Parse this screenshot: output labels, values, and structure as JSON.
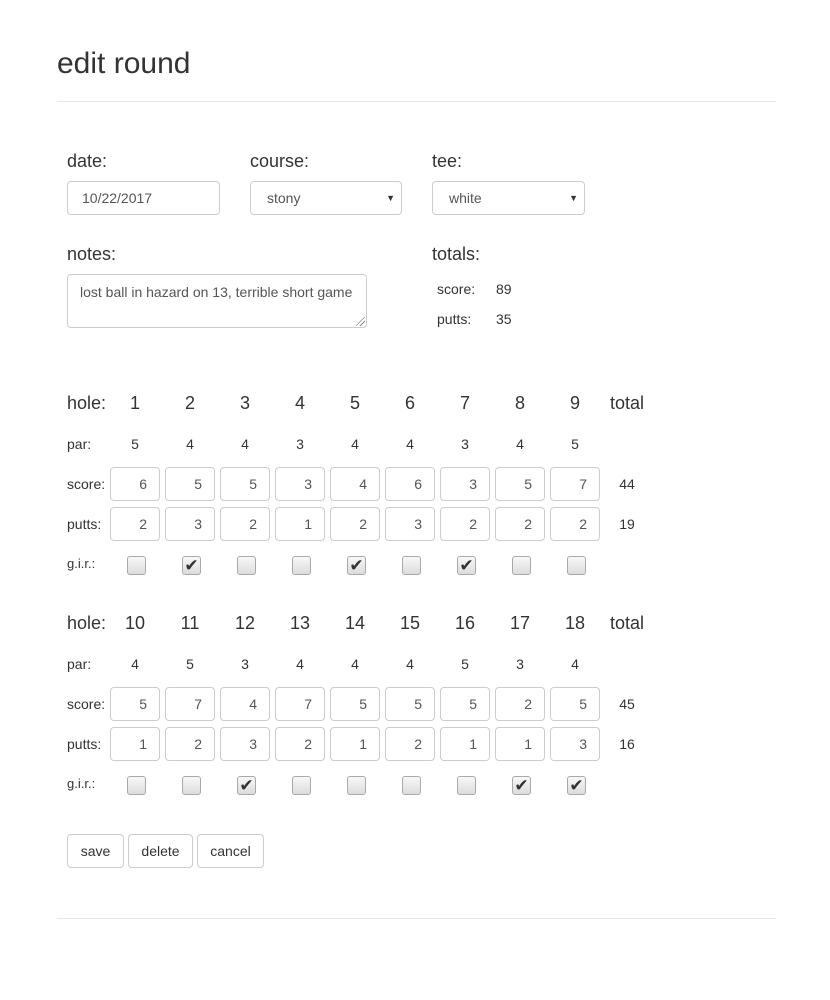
{
  "page": {
    "title": "edit round"
  },
  "form": {
    "date": {
      "label": "date:",
      "value": "10/22/2017"
    },
    "course": {
      "label": "course:",
      "value": "stony"
    },
    "tee": {
      "label": "tee:",
      "value": "white"
    },
    "notes": {
      "label": "notes:",
      "value": "lost ball in hazard on 13, terrible short game"
    },
    "totals": {
      "label": "totals:",
      "score_label": "score:",
      "score_value": "89",
      "putts_label": "putts:",
      "putts_value": "35"
    }
  },
  "row_labels": {
    "hole": "hole:",
    "par": "par:",
    "score": "score:",
    "putts": "putts:",
    "gir": "g.i.r.:",
    "total": "total"
  },
  "icons": {
    "select_caret": "chevron-down-icon",
    "checkmark": "checkmark-icon",
    "resize": "resize-grip-icon"
  },
  "nines": [
    {
      "holes": [
        "1",
        "2",
        "3",
        "4",
        "5",
        "6",
        "7",
        "8",
        "9"
      ],
      "par": [
        "5",
        "4",
        "4",
        "3",
        "4",
        "4",
        "3",
        "4",
        "5"
      ],
      "score": [
        "6",
        "5",
        "5",
        "3",
        "4",
        "6",
        "3",
        "5",
        "7"
      ],
      "putts": [
        "2",
        "3",
        "2",
        "1",
        "2",
        "3",
        "2",
        "2",
        "2"
      ],
      "gir": [
        false,
        true,
        false,
        false,
        true,
        false,
        true,
        false,
        false
      ],
      "score_total": "44",
      "putts_total": "19"
    },
    {
      "holes": [
        "10",
        "11",
        "12",
        "13",
        "14",
        "15",
        "16",
        "17",
        "18"
      ],
      "par": [
        "4",
        "5",
        "3",
        "4",
        "4",
        "4",
        "5",
        "3",
        "4"
      ],
      "score": [
        "5",
        "7",
        "4",
        "7",
        "5",
        "5",
        "5",
        "2",
        "5"
      ],
      "putts": [
        "1",
        "2",
        "3",
        "2",
        "1",
        "2",
        "1",
        "1",
        "3"
      ],
      "gir": [
        false,
        false,
        true,
        false,
        false,
        false,
        false,
        true,
        true
      ],
      "score_total": "45",
      "putts_total": "16"
    }
  ],
  "buttons": {
    "save": "save",
    "delete": "delete",
    "cancel": "cancel"
  }
}
